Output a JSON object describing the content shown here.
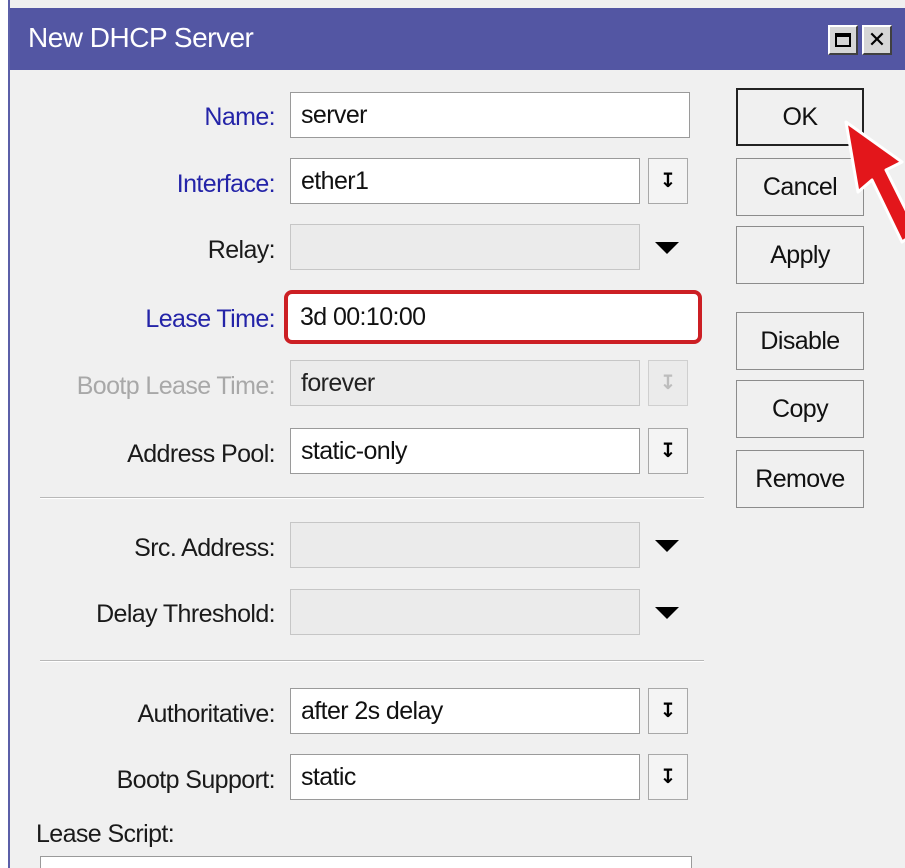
{
  "window": {
    "title": "New DHCP Server"
  },
  "titlebar_buttons": {
    "maximize_icon": "maximize-icon",
    "close_icon": "close-icon",
    "close_glyph": "✕"
  },
  "form": {
    "name": {
      "label": "Name:",
      "value": "server"
    },
    "interface": {
      "label": "Interface:",
      "value": "ether1"
    },
    "relay": {
      "label": "Relay:",
      "value": ""
    },
    "lease_time": {
      "label": "Lease Time:",
      "value": "3d 00:10:00"
    },
    "bootp_lease_time": {
      "label": "Bootp Lease Time:",
      "value": "forever"
    },
    "address_pool": {
      "label": "Address Pool:",
      "value": "static-only"
    },
    "src_address": {
      "label": "Src. Address:",
      "value": ""
    },
    "delay_threshold": {
      "label": "Delay Threshold:",
      "value": ""
    },
    "authoritative": {
      "label": "Authoritative:",
      "value": "after 2s delay"
    },
    "bootp_support": {
      "label": "Bootp Support:",
      "value": "static"
    },
    "lease_script": {
      "label": "Lease Script:"
    }
  },
  "buttons": {
    "ok": "OK",
    "cancel": "Cancel",
    "apply": "Apply",
    "disable": "Disable",
    "copy": "Copy",
    "remove": "Remove"
  },
  "colors": {
    "titlebar": "#5356a3",
    "required_label": "#2424a8",
    "highlight_border": "#cc1f24",
    "pointer_arrow": "#e3161b"
  }
}
